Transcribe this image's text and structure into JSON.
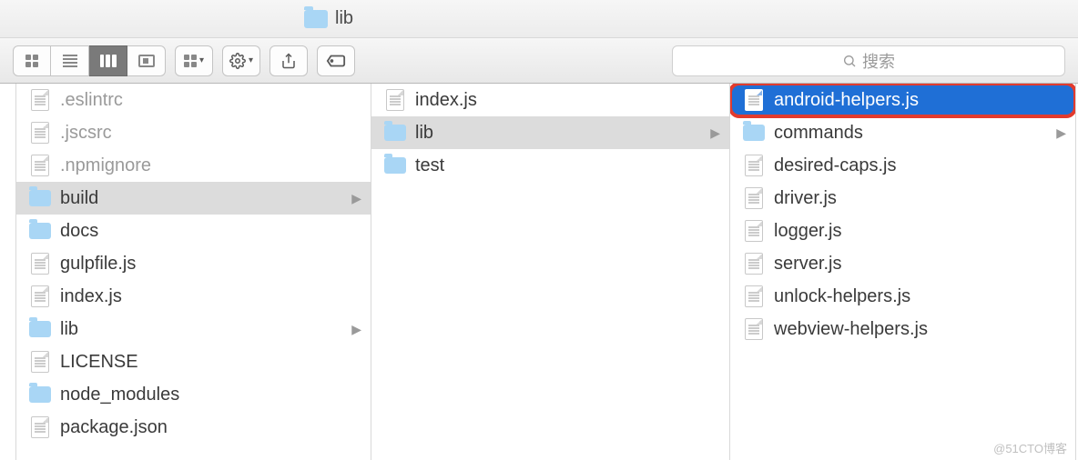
{
  "window": {
    "title": "lib"
  },
  "toolbar": {
    "search_placeholder": "搜索"
  },
  "columns": [
    {
      "items": [
        {
          "name": ".eslintrc",
          "type": "file",
          "dim": true
        },
        {
          "name": ".jscsrc",
          "type": "file",
          "dim": true
        },
        {
          "name": ".npmignore",
          "type": "file",
          "dim": true
        },
        {
          "name": "build",
          "type": "folder",
          "hasChildren": true,
          "selected": "grey"
        },
        {
          "name": "docs",
          "type": "folder"
        },
        {
          "name": "gulpfile.js",
          "type": "file"
        },
        {
          "name": "index.js",
          "type": "file"
        },
        {
          "name": "lib",
          "type": "folder",
          "hasChildren": true
        },
        {
          "name": "LICENSE",
          "type": "file"
        },
        {
          "name": "node_modules",
          "type": "folder"
        },
        {
          "name": "package.json",
          "type": "file"
        }
      ]
    },
    {
      "items": [
        {
          "name": "index.js",
          "type": "file"
        },
        {
          "name": "lib",
          "type": "folder",
          "hasChildren": true,
          "selected": "grey"
        },
        {
          "name": "test",
          "type": "folder"
        }
      ]
    },
    {
      "items": [
        {
          "name": "android-helpers.js",
          "type": "file",
          "selected": "blue",
          "highlight": true
        },
        {
          "name": "commands",
          "type": "folder",
          "hasChildren": true
        },
        {
          "name": "desired-caps.js",
          "type": "file"
        },
        {
          "name": "driver.js",
          "type": "file"
        },
        {
          "name": "logger.js",
          "type": "file"
        },
        {
          "name": "server.js",
          "type": "file"
        },
        {
          "name": "unlock-helpers.js",
          "type": "file"
        },
        {
          "name": "webview-helpers.js",
          "type": "file"
        }
      ]
    }
  ],
  "watermark": "@51CTO博客"
}
